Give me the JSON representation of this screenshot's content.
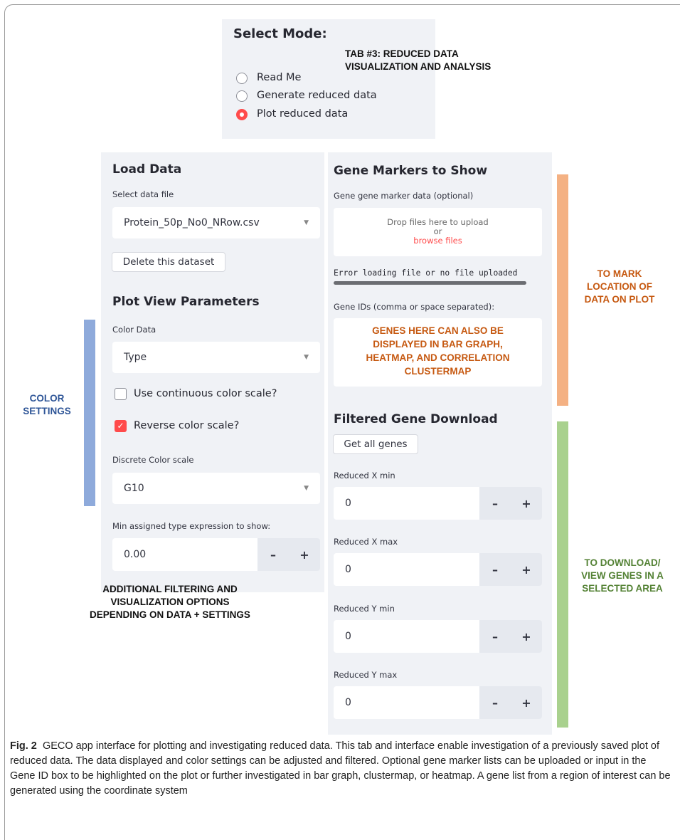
{
  "mode": {
    "title": "Select Mode:",
    "options": [
      {
        "label": "Read Me",
        "selected": false
      },
      {
        "label": "Generate reduced data",
        "selected": false
      },
      {
        "label": "Plot reduced data",
        "selected": true
      }
    ]
  },
  "left": {
    "load_title": "Load Data",
    "file_label": "Select data file",
    "file_value": "Protein_50p_No0_NRow.csv",
    "delete_label": "Delete this dataset",
    "params_title": "Plot View Parameters",
    "color_data_label": "Color Data",
    "color_data_value": "Type",
    "continuous_label": "Use continuous color scale?",
    "continuous_checked": false,
    "reverse_label": "Reverse color scale?",
    "reverse_checked": true,
    "discrete_label": "Discrete Color scale",
    "discrete_value": "G10",
    "min_expr_label": "Min assigned type expression to show:",
    "min_expr_value": "0.00"
  },
  "right": {
    "markers_title": "Gene Markers to Show",
    "marker_label": "Gene gene marker data (optional)",
    "drop_text": "Drop files here to upload",
    "drop_or": "or",
    "browse_text": "browse files",
    "error_text": "Error loading file or no file uploaded",
    "gene_ids_label": "Gene IDs (comma or space separated):",
    "download_title": "Filtered Gene Download",
    "get_all_label": "Get all genes",
    "x_min_label": "Reduced X min",
    "x_min_value": "0",
    "x_max_label": "Reduced X max",
    "x_max_value": "0",
    "y_min_label": "Reduced Y min",
    "y_min_value": "0",
    "y_max_label": "Reduced Y max",
    "y_max_value": "0",
    "minus": "–",
    "plus": "+"
  },
  "annotations": {
    "tab_line1": "TAB #3: REDUCED DATA",
    "tab_line2": "VISUALIZATION AND ANALYSIS",
    "genes_line1": "GENES HERE CAN ALSO BE",
    "genes_line2": "DISPLAYED IN BAR GRAPH,",
    "genes_line3": "HEATMAP, AND CORRELATION",
    "genes_line4": "CLUSTERMAP",
    "color_line1": "COLOR",
    "color_line2": "SETTINGS",
    "mark_line1": "TO MARK",
    "mark_line2": "LOCATION OF",
    "mark_line3": "DATA ON PLOT",
    "download_line1": "TO DOWNLOAD/",
    "download_line2": "VIEW GENES IN A",
    "download_line3": "SELECTED AREA",
    "filter_line1": "ADDITIONAL FILTERING AND",
    "filter_line2": "VISUALIZATION OPTIONS",
    "filter_line3": "DEPENDING ON DATA + SETTINGS",
    "orange": "#c65911",
    "blue": "#2e5597",
    "green": "#548235",
    "bar_blue": "#8eaadb",
    "bar_orange": "#f4b183",
    "bar_green": "#a9d18e"
  },
  "caption": {
    "fig_label": "Fig. 2",
    "text": "GECO app interface for plotting and investigating reduced data. This tab and interface enable investigation of a previously saved plot of reduced data. The data displayed and color settings can be adjusted and filtered. Optional gene marker lists can be uploaded or input in the Gene ID box to be highlighted on the plot or further investigated in bar graph, clustermap, or heatmap. A gene list from a region of interest can be generated using the coordinate system"
  }
}
